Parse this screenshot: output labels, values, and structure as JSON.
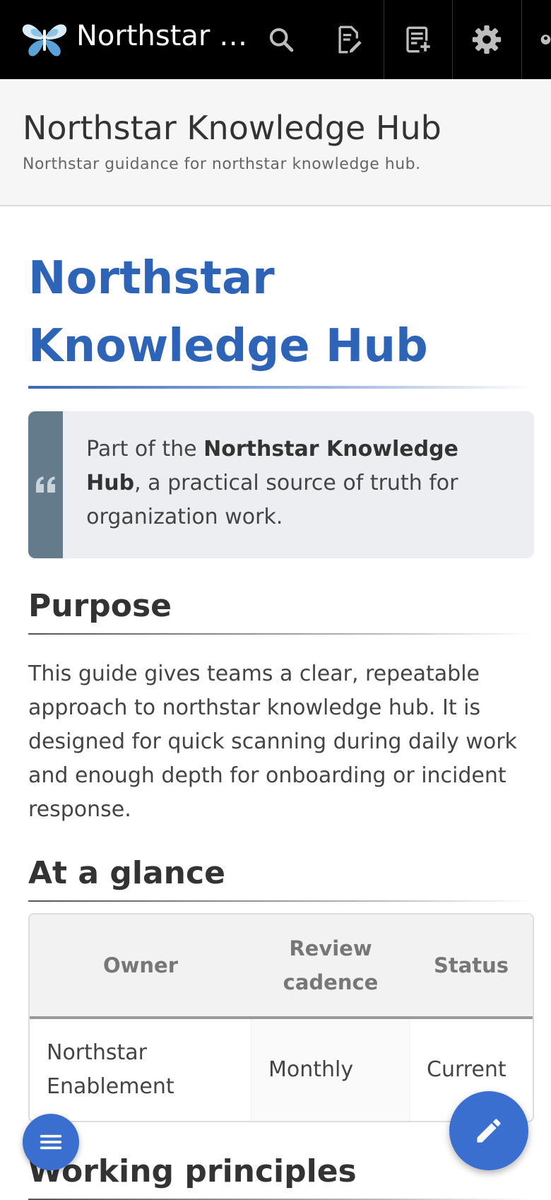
{
  "topbar": {
    "site_title": "Northstar …",
    "icons": [
      "logo-icon",
      "search-icon",
      "edit-page-icon",
      "new-page-icon",
      "settings-icon",
      "user-icon"
    ]
  },
  "subheader": {
    "title": "Northstar Knowledge Hub",
    "description": "Northstar guidance for northstar knowledge hub."
  },
  "page": {
    "title": "Northstar Knowledge Hub",
    "callout": {
      "prefix": "Part of the ",
      "bold": "Northstar Knowledge Hub",
      "suffix": ", a practical source of truth for organization work."
    },
    "purpose": {
      "heading": "Purpose",
      "body": "This guide gives teams a clear, repeatable approach to northstar knowledge hub. It is designed for quick scanning during daily work and enough depth for onboarding or incident response."
    },
    "glance": {
      "heading": "At a glance",
      "columns": [
        "Owner",
        "Review cadence",
        "Status"
      ],
      "rows": [
        [
          "Northstar Enablement",
          "Monthly",
          "Current"
        ]
      ]
    },
    "principles": {
      "heading": "Working principles"
    }
  },
  "colors": {
    "topbar_bg": "#000000",
    "accent": "#2d64b8",
    "fab": "#3a6fd0",
    "callout_side": "#637b8b"
  }
}
